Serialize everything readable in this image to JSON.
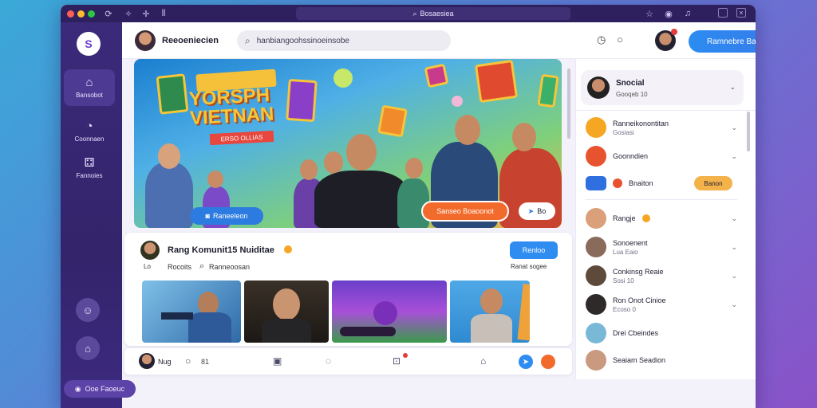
{
  "titlebar": {
    "url": "Bosaesiea",
    "window_dots": [
      "#ff5f57",
      "#febc2e",
      "#28c840"
    ]
  },
  "sidebar": {
    "logo": "S",
    "items": [
      {
        "label": "Bansobot",
        "icon": "home-icon",
        "glyph": "⌂"
      },
      {
        "label": "Coonnaen",
        "icon": "dashboard-icon",
        "glyph": "◔"
      },
      {
        "label": "Fannoies",
        "icon": "games-icon",
        "glyph": "⚃"
      }
    ]
  },
  "topbar": {
    "user_name": "Reeoeniecien",
    "search_placeholder": "hanbiangoohssinoeinsobe",
    "cta_label": "Ramnebre Banet",
    "cta_icon": "send-icon"
  },
  "hero": {
    "title_line1": "YORSPH",
    "title_line2": "VIETNAN",
    "subtitle": "ERSO OLLIAS",
    "left_pill": "Raneeleon",
    "cta_pill": "Sanseo Boaoonot",
    "badge": "Bo"
  },
  "post": {
    "author": "Rang Komunit15 Nuiditae",
    "meta_left": "Lo",
    "meta_action": "Rocoits",
    "meta_search": "Ranneoosan",
    "follow_label": "Renloo",
    "time_label": "Ranat sogee"
  },
  "bottombar": {
    "user": "Nug",
    "count": "81"
  },
  "rightpanel": {
    "header": {
      "title": "Snocial",
      "subtitle": "Gooqeb 10"
    },
    "items": [
      {
        "title": "Ranneikonontitan",
        "subtitle": "Gosiasi",
        "color": "#f5a623"
      },
      {
        "title": "Goonndien",
        "subtitle": "",
        "color": "#e8532f"
      },
      {
        "title": "Bnaiton",
        "subtitle": "",
        "color": "#2f6fe0",
        "pill": "Banon"
      },
      {
        "title": "Rangje",
        "subtitle": "",
        "color": "#d9a07a"
      },
      {
        "title": "Sonoenent",
        "subtitle": "Lua Eaio",
        "color": "#8a6a5a"
      },
      {
        "title": "Conkinsg Reaie",
        "subtitle": "Sosi 10",
        "color": "#5e4a3a"
      },
      {
        "title": "Ron Onot Cinioe",
        "subtitle": "Ecoso 0",
        "color": "#2e2a2a"
      },
      {
        "title": "Drei Cbeindes",
        "subtitle": "",
        "color": "#7ab8d8"
      },
      {
        "title": "Seaiam Seadion",
        "subtitle": "",
        "color": "#c99a80"
      }
    ]
  },
  "chip": {
    "label": "Ooe Faoeuc"
  }
}
